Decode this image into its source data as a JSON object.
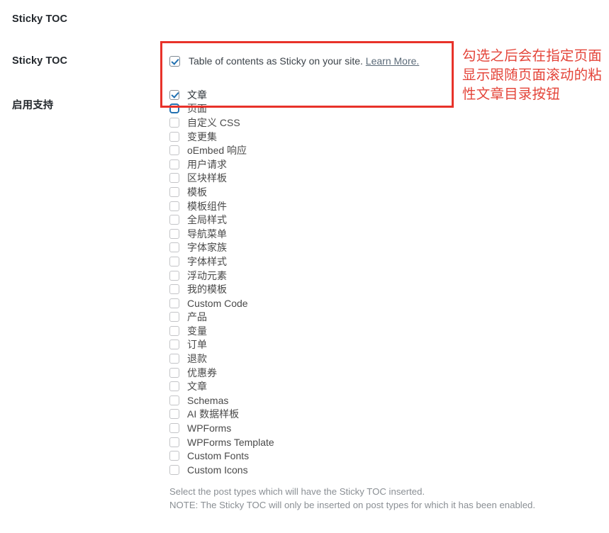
{
  "sidebar": {
    "labels": [
      {
        "text": "Sticky TOC"
      },
      {
        "text": "Sticky TOC"
      },
      {
        "text": "启用支持"
      }
    ]
  },
  "sticky_setting": {
    "label": "Table of contents as Sticky on your site.",
    "link_label": "Learn More.",
    "checked": true
  },
  "post_types": [
    {
      "label": "文章",
      "checked": true,
      "focused": false
    },
    {
      "label": "页面",
      "checked": false,
      "focused": true
    },
    {
      "label": "自定义 CSS",
      "checked": false,
      "focused": false
    },
    {
      "label": "变更集",
      "checked": false,
      "focused": false
    },
    {
      "label": "oEmbed 响应",
      "checked": false,
      "focused": false
    },
    {
      "label": "用户请求",
      "checked": false,
      "focused": false
    },
    {
      "label": "区块样板",
      "checked": false,
      "focused": false
    },
    {
      "label": "模板",
      "checked": false,
      "focused": false
    },
    {
      "label": "模板组件",
      "checked": false,
      "focused": false
    },
    {
      "label": "全局样式",
      "checked": false,
      "focused": false
    },
    {
      "label": "导航菜单",
      "checked": false,
      "focused": false
    },
    {
      "label": "字体家族",
      "checked": false,
      "focused": false
    },
    {
      "label": "字体样式",
      "checked": false,
      "focused": false
    },
    {
      "label": "浮动元素",
      "checked": false,
      "focused": false
    },
    {
      "label": "我的模板",
      "checked": false,
      "focused": false
    },
    {
      "label": "Custom Code",
      "checked": false,
      "focused": false
    },
    {
      "label": "产品",
      "checked": false,
      "focused": false
    },
    {
      "label": "变量",
      "checked": false,
      "focused": false
    },
    {
      "label": "订单",
      "checked": false,
      "focused": false
    },
    {
      "label": "退款",
      "checked": false,
      "focused": false
    },
    {
      "label": "优惠券",
      "checked": false,
      "focused": false
    },
    {
      "label": "文章",
      "checked": false,
      "focused": false
    },
    {
      "label": "Schemas",
      "checked": false,
      "focused": false
    },
    {
      "label": "AI 数据样板",
      "checked": false,
      "focused": false
    },
    {
      "label": "WPForms",
      "checked": false,
      "focused": false
    },
    {
      "label": "WPForms Template",
      "checked": false,
      "focused": false
    },
    {
      "label": "Custom Fonts",
      "checked": false,
      "focused": false
    },
    {
      "label": "Custom Icons",
      "checked": false,
      "focused": false
    }
  ],
  "help": {
    "line1": "Select the post types which will have the Sticky TOC inserted.",
    "line2": "NOTE: The Sticky TOC will only be inserted on post types for which it has been enabled."
  },
  "annotation": {
    "text": "勾选之后会在指定页面显示跟随页面滚动的粘性文章目录按钮",
    "box_color": "#e8322a",
    "text_color": "#e4453a"
  }
}
